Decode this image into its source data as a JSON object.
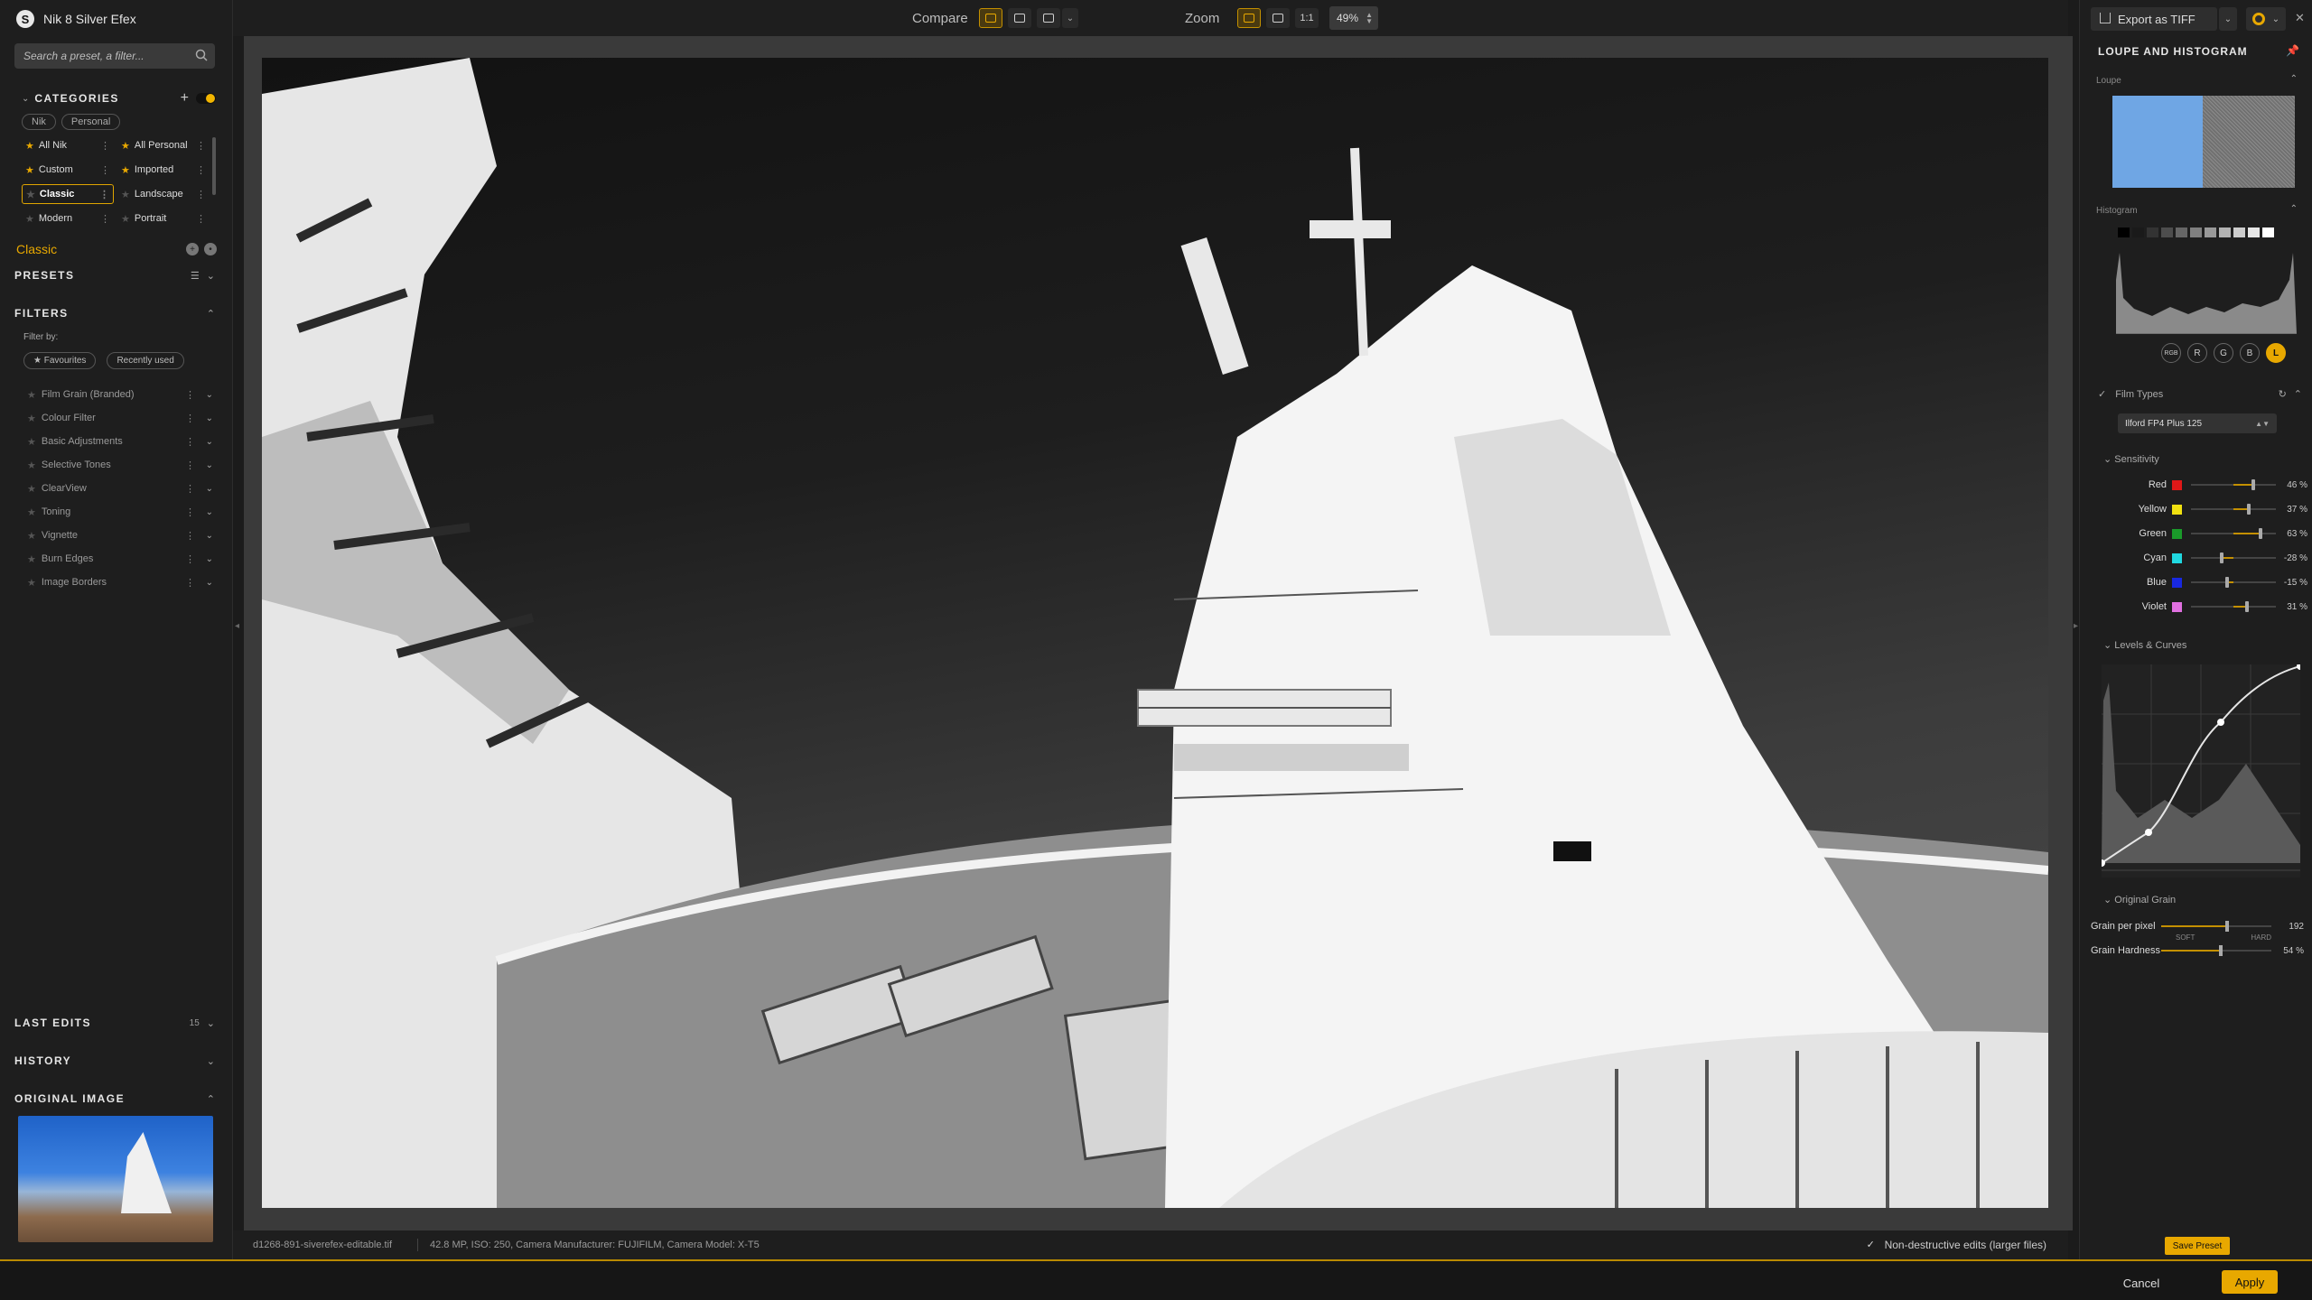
{
  "app": {
    "title": "Nik 8 Silver Efex",
    "logo_letter": "S"
  },
  "search": {
    "placeholder": "Search a preset, a filter..."
  },
  "categories": {
    "title": "CATEGORIES",
    "tabs": [
      "Nik",
      "Personal"
    ],
    "items": [
      {
        "label": "All Nik",
        "starred": true
      },
      {
        "label": "All Personal",
        "starred": true
      },
      {
        "label": "Custom",
        "starred": true
      },
      {
        "label": "Imported",
        "starred": true
      },
      {
        "label": "Classic",
        "starred": true,
        "selected": true
      },
      {
        "label": "Landscape",
        "starred": false
      },
      {
        "label": "Modern",
        "starred": true
      },
      {
        "label": "Portrait",
        "starred": false
      }
    ]
  },
  "current_category": "Classic",
  "presets": {
    "title": "PRESETS"
  },
  "filters": {
    "title": "FILTERS",
    "filter_by": "Filter by:",
    "pills": [
      "★ Favourites",
      "Recently used"
    ],
    "items": [
      "Film Grain (Branded)",
      "Colour Filter",
      "Basic Adjustments",
      "Selective Tones",
      "ClearView",
      "Toning",
      "Vignette",
      "Burn Edges",
      "Image Borders"
    ]
  },
  "last_edits": {
    "title": "LAST EDITS",
    "count": "15"
  },
  "history": {
    "title": "HISTORY"
  },
  "original_image": {
    "title": "ORIGINAL IMAGE"
  },
  "toolbar": {
    "compare_label": "Compare",
    "zoom_label": "Zoom",
    "one_to_one": "1:1",
    "zoom_value": "49%"
  },
  "status": {
    "filename": "d1268-891-siverefex-editable.tif",
    "info": "42.8 MP, ISO: 250, Camera Manufacturer: FUJIFILM, Camera Model: X-T5",
    "non_destructive": "Non-destructive edits (larger files)"
  },
  "right_panel": {
    "export_label": "Export as TIFF",
    "panel_title": "LOUPE AND HISTOGRAM",
    "loupe_label": "Loupe",
    "histogram_label": "Histogram",
    "channels": [
      "RGB",
      "R",
      "G",
      "B",
      "L"
    ],
    "film_types_label": "Film Types",
    "film_selected": "Ilford FP4 Plus 125",
    "sensitivity_label": "Sensitivity",
    "sensitivity": [
      {
        "name": "Red",
        "color": "#e01818",
        "value": 46,
        "display": "46 %"
      },
      {
        "name": "Yellow",
        "color": "#f0e010",
        "value": 37,
        "display": "37 %"
      },
      {
        "name": "Green",
        "color": "#1a9a2a",
        "value": 63,
        "display": "63 %"
      },
      {
        "name": "Cyan",
        "color": "#20d8e0",
        "value": -28,
        "display": "-28 %"
      },
      {
        "name": "Blue",
        "color": "#1828e0",
        "value": -15,
        "display": "-15 %"
      },
      {
        "name": "Violet",
        "color": "#e070e0",
        "value": 31,
        "display": "31 %"
      }
    ],
    "levels_label": "Levels & Curves",
    "original_grain_label": "Original Grain",
    "grain_per_pixel_label": "Grain per pixel",
    "grain_per_pixel": "192",
    "grain_per_pixel_fraction": 0.6,
    "soft_label": "SOFT",
    "hard_label": "HARD",
    "grain_hardness_label": "Grain Hardness",
    "grain_hardness": "54 %",
    "grain_hardness_fraction": 0.54,
    "save_preset": "Save Preset"
  },
  "footer": {
    "cancel": "Cancel",
    "apply": "Apply"
  },
  "colors": {
    "accent": "#e8a800"
  }
}
